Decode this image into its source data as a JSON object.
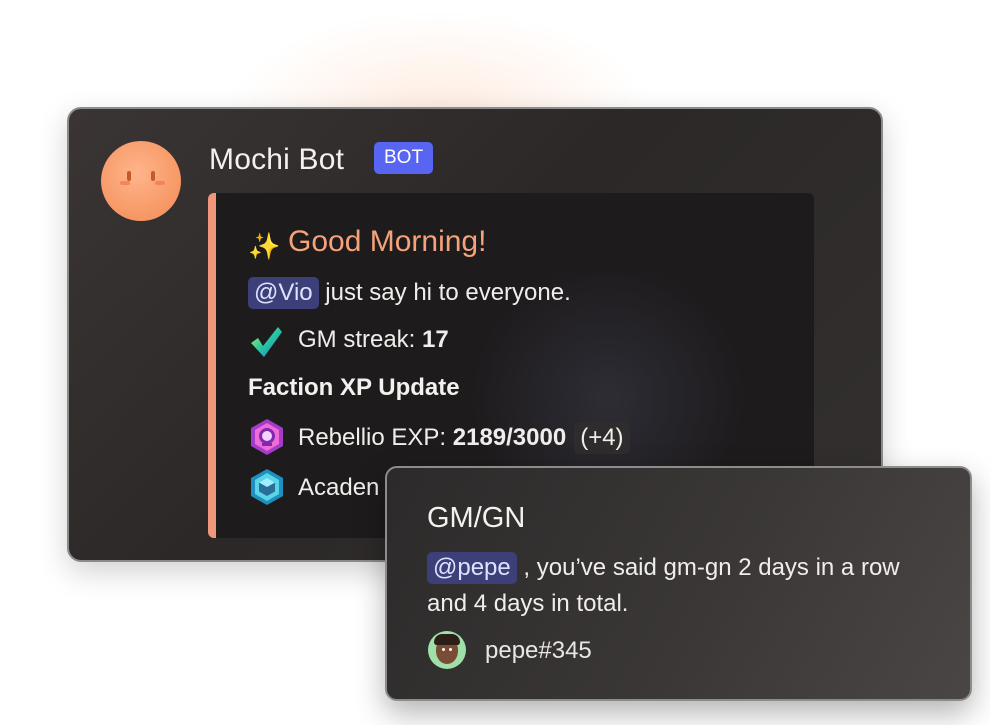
{
  "bot_message": {
    "author_name": "Mochi Bot",
    "badge": "BOT",
    "embed": {
      "title_icon": "sparkles-icon",
      "title": "Good Morning!",
      "greeting": {
        "mention": "@Vio",
        "text": " just say hi to everyone."
      },
      "streak": {
        "icon": "check-mark-icon",
        "label": "GM streak: ",
        "value": "17"
      },
      "faction_heading": "Faction XP Update",
      "factions": [
        {
          "icon": "rebellio-faction-icon",
          "label": "Rebellio EXP: ",
          "value": "2189/3000",
          "delta": "(+4)"
        },
        {
          "icon": "academy-faction-icon",
          "label_visible": "Acaden"
        }
      ],
      "accent_color": "#f0967a"
    }
  },
  "gm_card": {
    "title": "GM/GN",
    "mention": "@pepe",
    "message_text": " , you’ve said gm-gn 2 days in a row and 4 days in total.",
    "user_name": "pepe#345"
  },
  "colors": {
    "badge_bg": "#5865f2",
    "title_accent": "#f5a27a",
    "mention_bg": "#3c3f78"
  }
}
